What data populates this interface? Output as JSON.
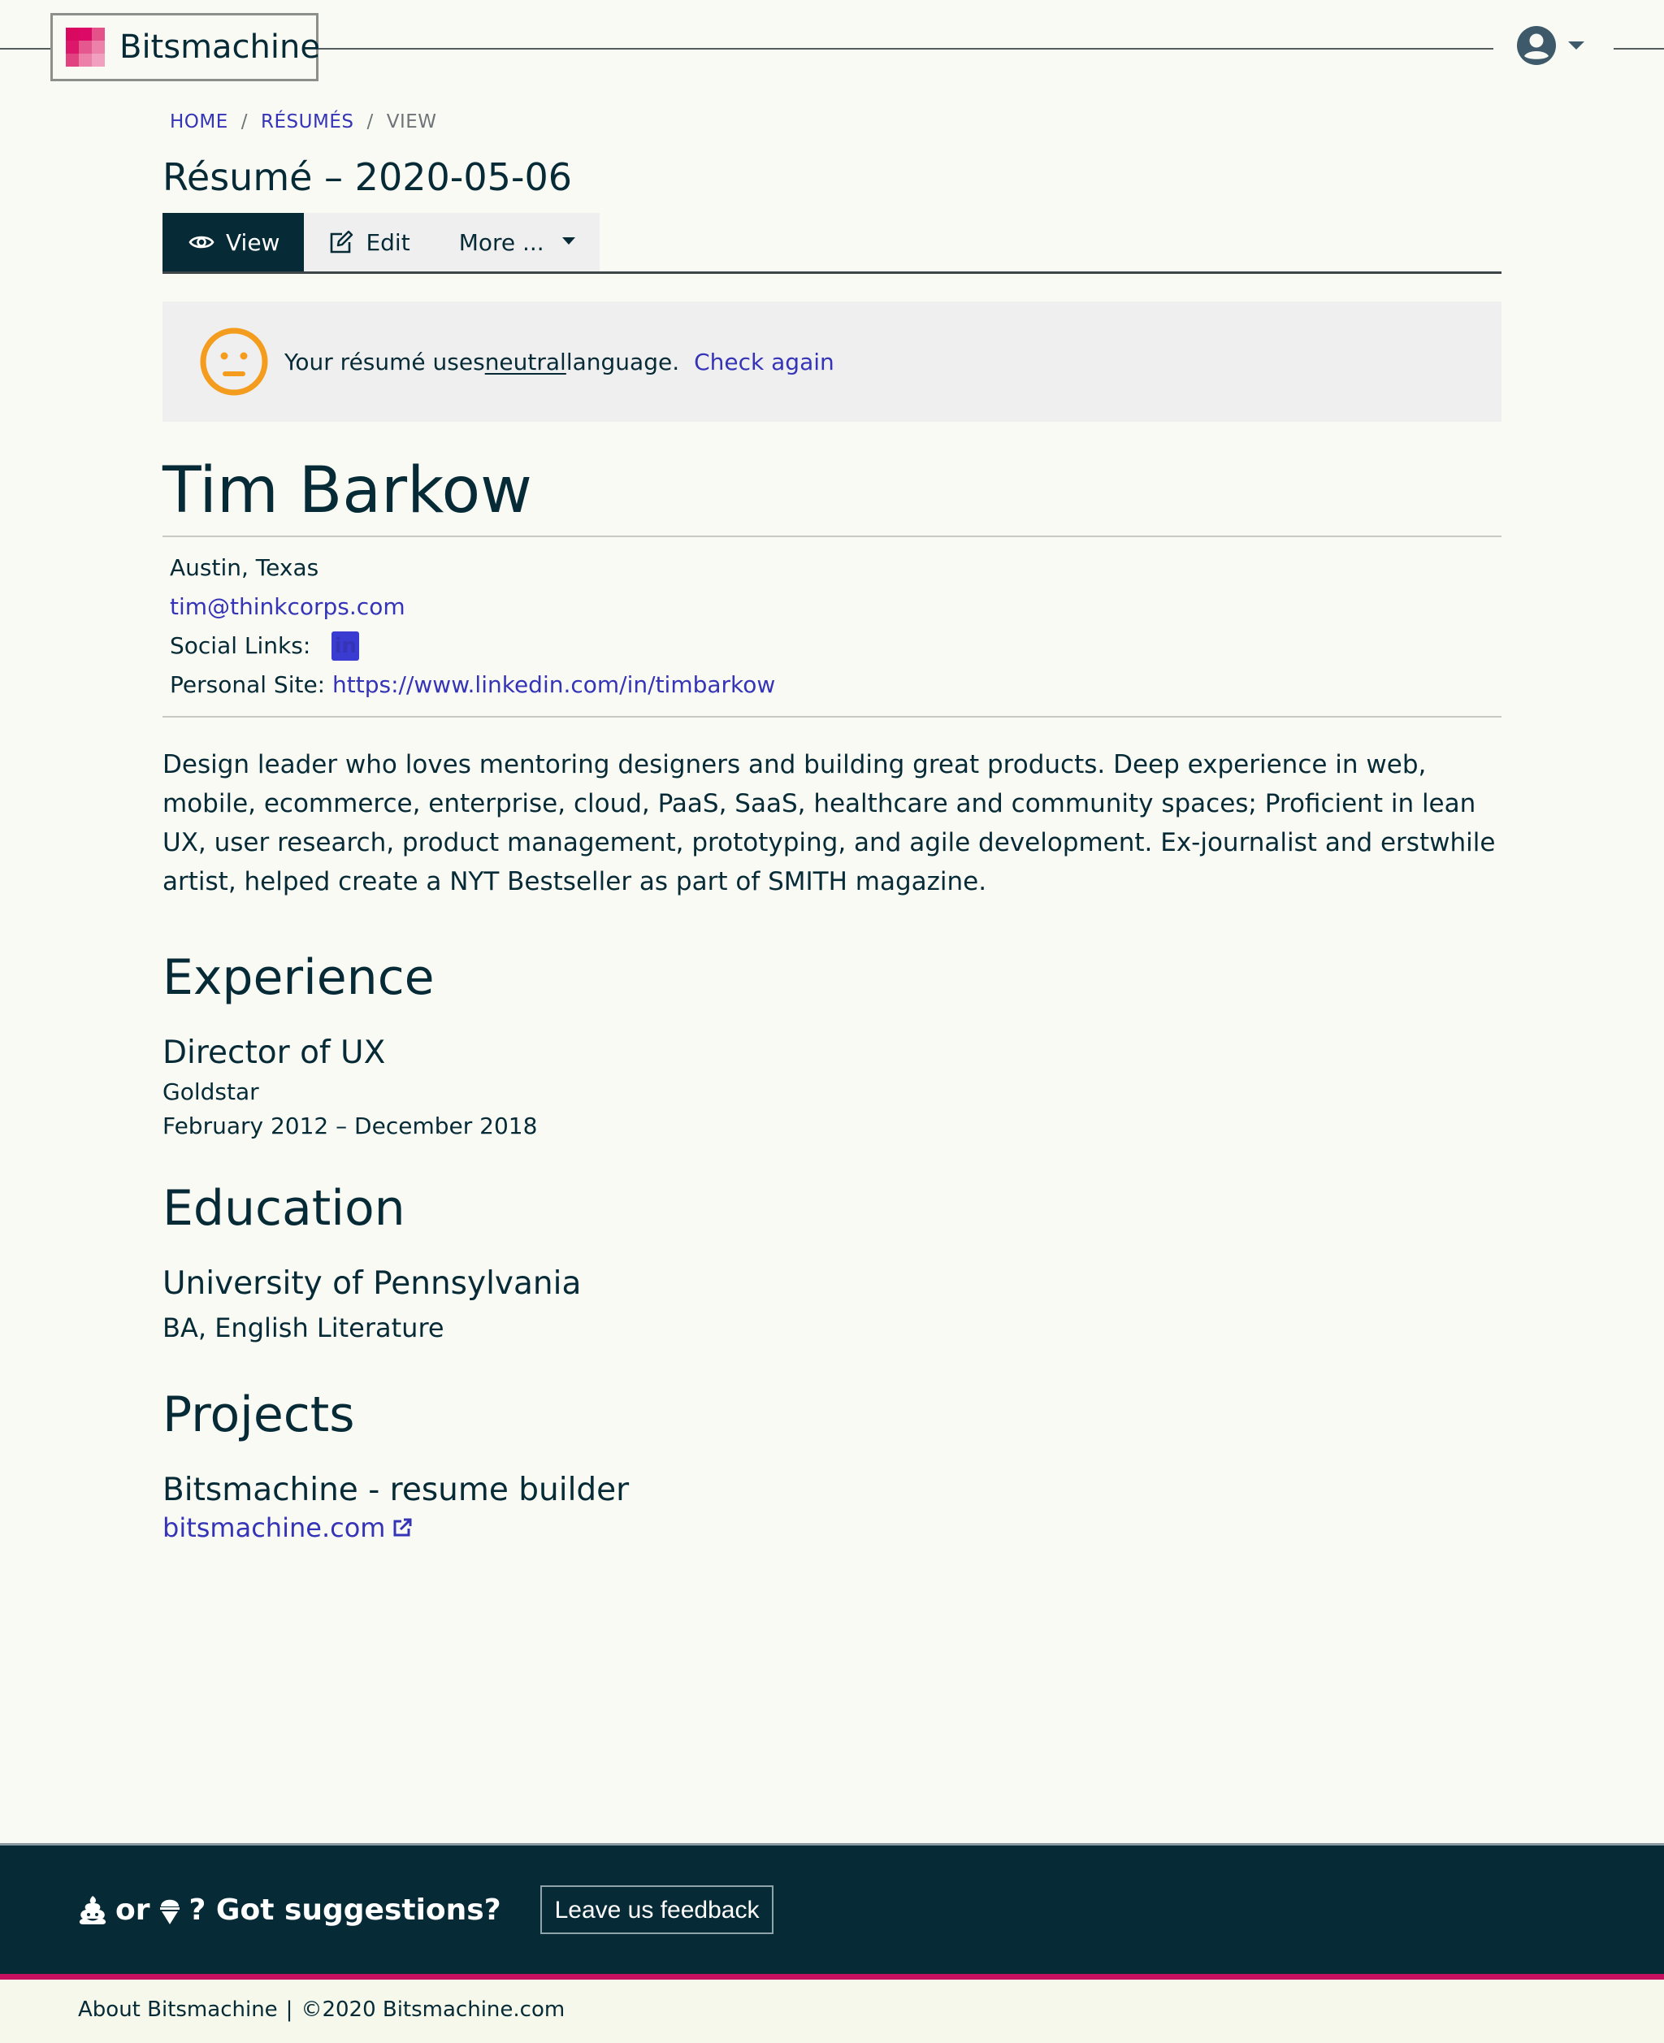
{
  "header": {
    "brand_name": "Bitsmachine",
    "logo_icon": "pixel-grid-logo",
    "user_icon": "user-circle-icon",
    "user_menu_caret": "caret-down-icon"
  },
  "breadcrumb": [
    {
      "label": "HOME",
      "link": true
    },
    {
      "label": "RÉSUMÉS",
      "link": true
    },
    {
      "label": "VIEW",
      "link": false
    }
  ],
  "breadcrumb_separator": "/",
  "page_title": "Résumé – 2020-05-06",
  "tabs": [
    {
      "label": "View",
      "icon": "eye-icon",
      "active": true
    },
    {
      "label": "Edit",
      "icon": "edit-icon",
      "active": false
    },
    {
      "label": "More ...",
      "icon": "caret-down-icon",
      "active": false
    }
  ],
  "alert": {
    "icon": "neutral-face-icon",
    "text_before": "Your résumé uses ",
    "emphasis": "neutral",
    "text_after": " language.",
    "action_label": "Check again"
  },
  "profile": {
    "name": "Tim Barkow",
    "location": "Austin, Texas",
    "email": "tim@thinkcorps.com",
    "social_label": "Social Links:",
    "social_links": [
      {
        "network": "LinkedIn",
        "icon": "linkedin-icon",
        "glyph": "in"
      }
    ],
    "personal_site_label": "Personal Site:",
    "personal_site": "https://www.linkedin.com/in/timbarkow",
    "summary": "Design leader who loves mentoring designers and building great products. Deep experience in web, mobile, ecommerce, enterprise, cloud, PaaS, SaaS, healthcare and community spaces; Proficient in lean UX, user research, product management, prototyping, and agile development. Ex-journalist and erstwhile artist, helped create a NYT Bestseller as part of SMITH magazine."
  },
  "experience": {
    "title": "Experience",
    "items": [
      {
        "role": "Director of UX",
        "company": "Goldstar",
        "dates": "February 2012 – December 2018"
      }
    ]
  },
  "education": {
    "title": "Education",
    "items": [
      {
        "school": "University of Pennsylvania",
        "degree": "BA, English Literature"
      }
    ]
  },
  "projects": {
    "title": "Projects",
    "items": [
      {
        "name": "Bitsmachine - resume builder",
        "link": "bitsmachine.com",
        "link_icon": "external-link-icon"
      }
    ]
  },
  "footer": {
    "icon_a": "poop-icon",
    "or_text": "or",
    "icon_b": "ice-cream-icon",
    "question": "? Got suggestions?",
    "feedback_button": "Leave us feedback",
    "about_link": "About Bitsmachine",
    "separator": "|",
    "copyright": "©2020 Bitsmachine.com"
  },
  "colors": {
    "brand_pink": "#d9095f",
    "dark_navy": "#072b36",
    "link_blue": "#3534b7",
    "alert_orange": "#f39c1e",
    "page_bg": "#f9faf4"
  }
}
